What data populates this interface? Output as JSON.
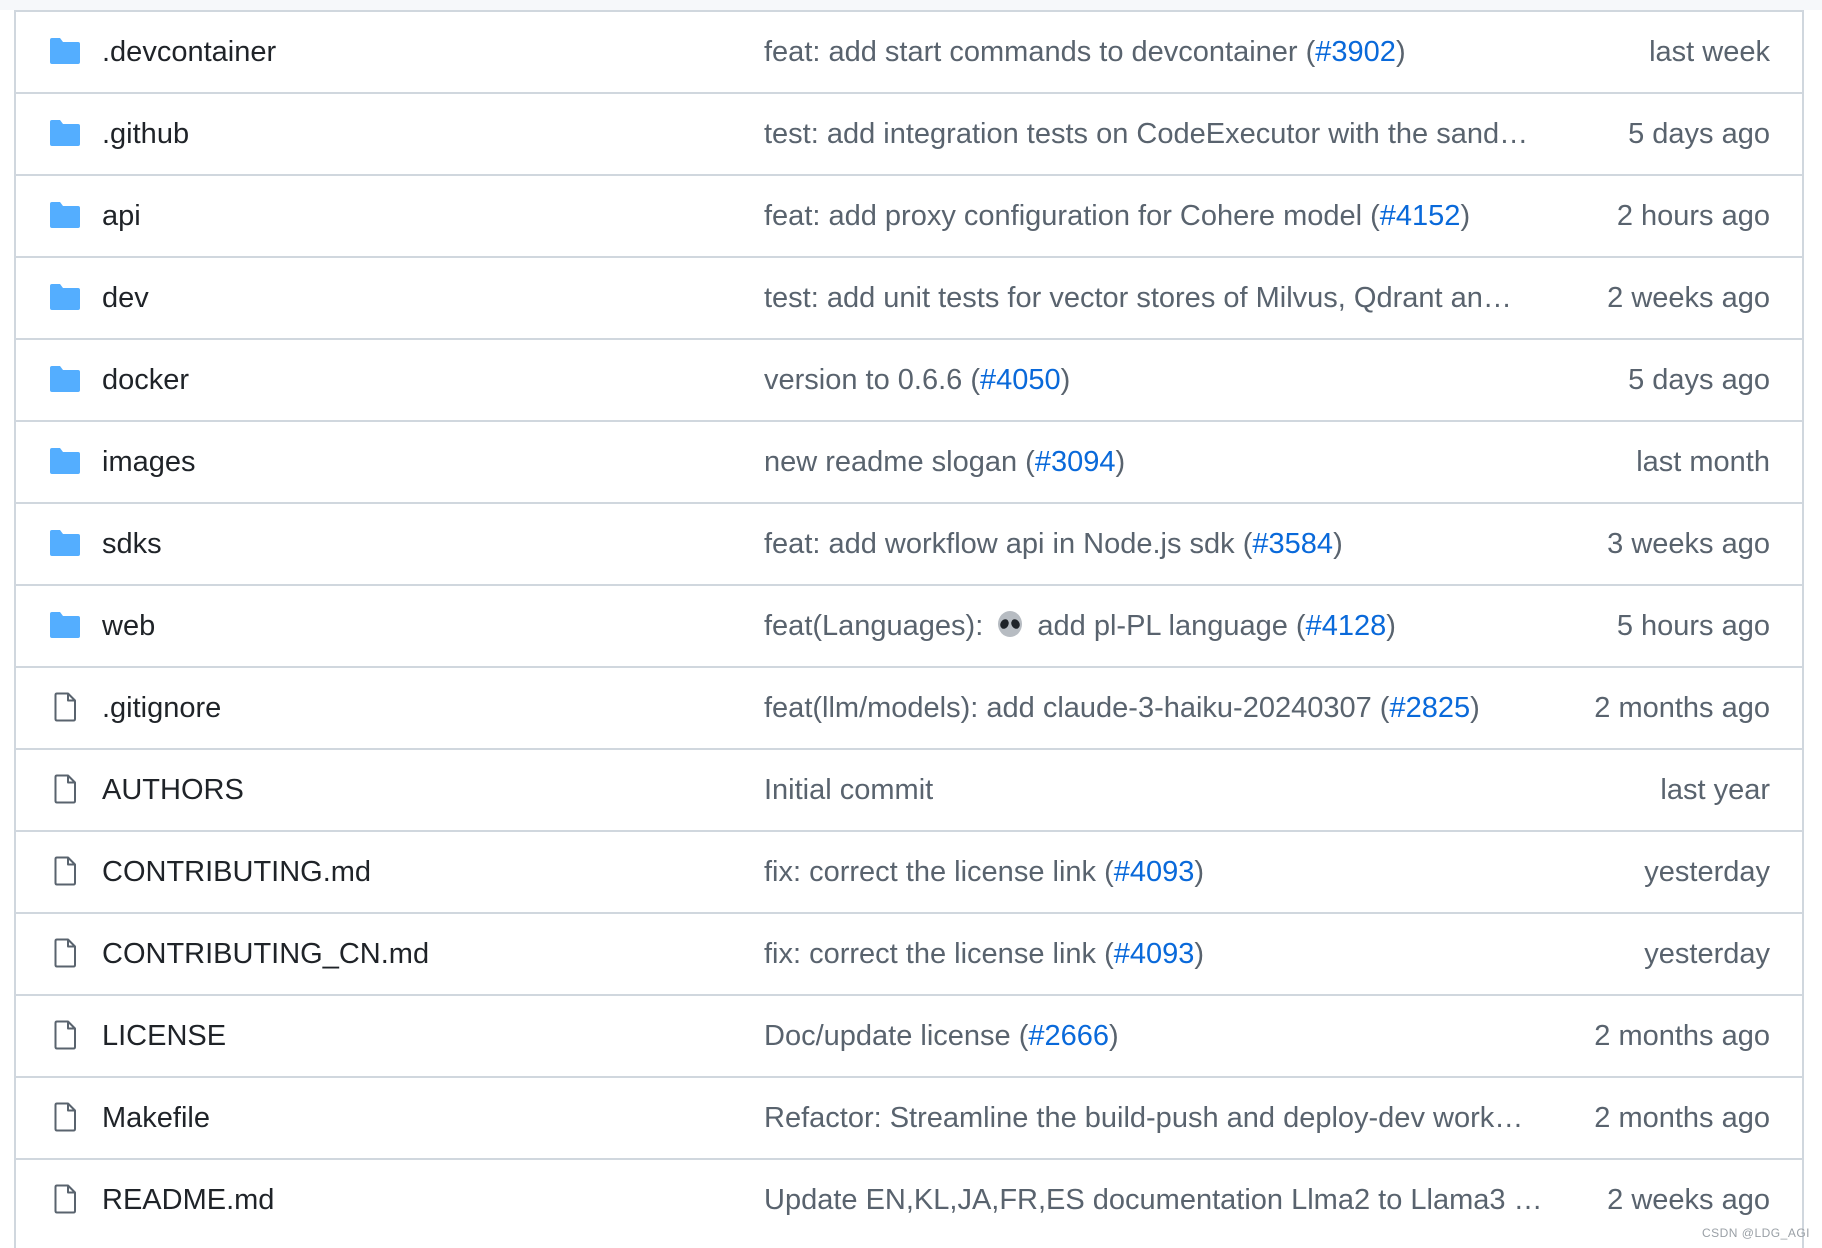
{
  "files": [
    {
      "type": "dir",
      "name": ".devcontainer",
      "message": "feat: add start commands to devcontainer",
      "pr": "#3902",
      "date": "last week"
    },
    {
      "type": "dir",
      "name": ".github",
      "message": "test: add integration tests on CodeExecutor with the sand…",
      "pr": "",
      "date": "5 days ago"
    },
    {
      "type": "dir",
      "name": "api",
      "message": "feat: add proxy configuration for Cohere model",
      "pr": "#4152",
      "date": "2 hours ago"
    },
    {
      "type": "dir",
      "name": "dev",
      "message": "test: add unit tests for vector stores of Milvus, Qdrant an…",
      "pr": "",
      "date": "2 weeks ago"
    },
    {
      "type": "dir",
      "name": "docker",
      "message": "version to 0.6.6",
      "pr": "#4050",
      "date": "5 days ago"
    },
    {
      "type": "dir",
      "name": "images",
      "message": "new readme slogan",
      "pr": "#3094",
      "date": "last month"
    },
    {
      "type": "dir",
      "name": "sdks",
      "message": "feat: add workflow api in Node.js sdk",
      "pr": "#3584",
      "date": "3 weeks ago"
    },
    {
      "type": "dir",
      "name": "web",
      "message_prefix": "feat(Languages):",
      "emoji": "alien-emoji",
      "message": "add pl-PL language",
      "pr": "#4128",
      "date": "5 hours ago"
    },
    {
      "type": "file",
      "name": ".gitignore",
      "message": "feat(llm/models): add claude-3-haiku-20240307",
      "pr": "#2825",
      "date": "2 months ago"
    },
    {
      "type": "file",
      "name": "AUTHORS",
      "message": "Initial commit",
      "pr": "",
      "date": "last year"
    },
    {
      "type": "file",
      "name": "CONTRIBUTING.md",
      "message": "fix: correct the license link",
      "pr": "#4093",
      "date": "yesterday"
    },
    {
      "type": "file",
      "name": "CONTRIBUTING_CN.md",
      "message": "fix: correct the license link",
      "pr": "#4093",
      "date": "yesterday"
    },
    {
      "type": "file",
      "name": "LICENSE",
      "message": "Doc/update license",
      "pr": "#2666",
      "date": "2 months ago"
    },
    {
      "type": "file",
      "name": "Makefile",
      "message": "Refactor: Streamline the build-push and deploy-dev work…",
      "pr": "",
      "date": "2 months ago"
    },
    {
      "type": "file",
      "name": "README.md",
      "message": "Update EN,KL,JA,FR,ES documentation Llma2 to Llama3 …",
      "pr": "",
      "date": "2 weeks ago"
    }
  ],
  "icons": {
    "dir": "folder-icon",
    "file": "file-icon"
  },
  "colors": {
    "folder": "#54aeff",
    "link": "#0969da",
    "muted": "#59636e",
    "border": "#d0d7de"
  },
  "watermark": "CSDN @LDG_AGI"
}
